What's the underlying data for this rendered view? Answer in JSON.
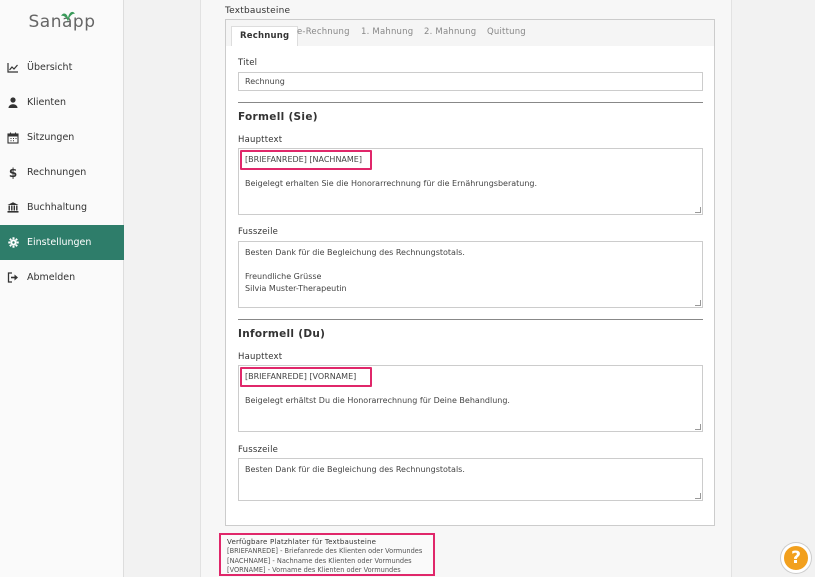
{
  "app": {
    "logo_text": "Sanapp"
  },
  "sidebar": {
    "items": [
      {
        "label": "Übersicht",
        "icon": "chart-line-icon"
      },
      {
        "label": "Klienten",
        "icon": "user-icon"
      },
      {
        "label": "Sitzungen",
        "icon": "calendar-icon"
      },
      {
        "label": "Rechnungen",
        "icon": "dollar-icon"
      },
      {
        "label": "Buchhaltung",
        "icon": "bank-icon"
      },
      {
        "label": "Einstellungen",
        "icon": "gear-icon"
      },
      {
        "label": "Abmelden",
        "icon": "sign-out-icon"
      }
    ],
    "active_index": 5
  },
  "section": {
    "title": "Textbausteine"
  },
  "tabs": [
    "Rechnung",
    "e-Rechnung",
    "1. Mahnung",
    "2. Mahnung",
    "Quittung"
  ],
  "form": {
    "titel_label": "Titel",
    "titel_value": "Rechnung",
    "formell": {
      "heading": "Formell (Sie)",
      "haupttext_label": "Haupttext",
      "haupttext_lines": [
        "[BRIEFANREDE] [NACHNAME]",
        "",
        "Beigelegt erhalten Sie die Honorarrechnung für die Ernährungsberatung."
      ],
      "fusszeile_label": "Fusszeile",
      "fusszeile_lines": [
        "Besten Dank für die Begleichung des Rechnungstotals.",
        "",
        "Freundliche Grüsse",
        "Silvia Muster-Therapeutin"
      ]
    },
    "informell": {
      "heading": "Informell (Du)",
      "haupttext_label": "Haupttext",
      "haupttext_lines": [
        "[BRIEFANREDE] [VORNAME]",
        "",
        "Beigelegt erhältst Du die Honorarrechnung für Deine Behandlung."
      ],
      "fusszeile_label": "Fusszeile",
      "fusszeile_lines": [
        "Besten Dank für die Begleichung des Rechnungstotals."
      ]
    }
  },
  "placeholders": {
    "title": "Verfügbare Platzhlater für Textbausteine",
    "lines": [
      "[BRIEFANREDE] - Briefanrede des Klienten oder Vormundes",
      "[NACHNAME] - Nachname des Klienten oder Vormundes",
      "[VORNAME] - Vorname des Klienten oder Vormundes"
    ]
  },
  "help": {
    "label": "?"
  },
  "colors": {
    "accent": "#2e7d6a",
    "highlight": "#e0276a",
    "help": "#f2a01e"
  }
}
